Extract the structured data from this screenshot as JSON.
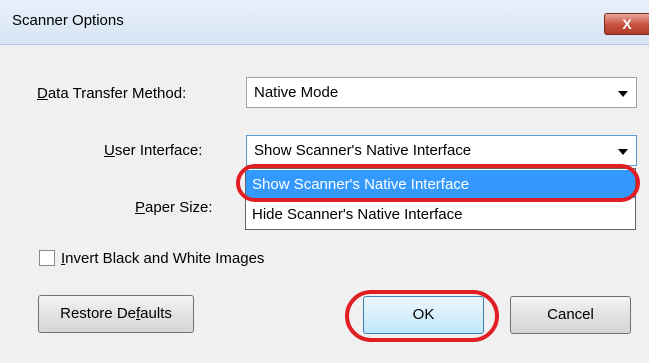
{
  "window": {
    "title": "Scanner Options",
    "close_label": "X"
  },
  "fields": {
    "transfer": {
      "label_pre": "",
      "label_u": "D",
      "label_post": "ata Transfer Method:",
      "value": "Native Mode"
    },
    "ui": {
      "label_pre": "",
      "label_u": "U",
      "label_post": "ser Interface:",
      "value": "Show Scanner's Native Interface"
    },
    "paper": {
      "label_pre": "",
      "label_u": "P",
      "label_post": "aper Size:"
    }
  },
  "dropdown": {
    "options": [
      "Show Scanner's Native Interface",
      "Hide Scanner's Native Interface"
    ],
    "selected_index": 0
  },
  "invert": {
    "label_u": "I",
    "label_post": "nvert Black and White Images",
    "checked": false
  },
  "buttons": {
    "restore_pre": "Restore De",
    "restore_u": "f",
    "restore_post": "aults",
    "ok": "OK",
    "cancel": "Cancel"
  },
  "colors": {
    "highlight": "#3399ff",
    "annotation": "#e01e24"
  }
}
